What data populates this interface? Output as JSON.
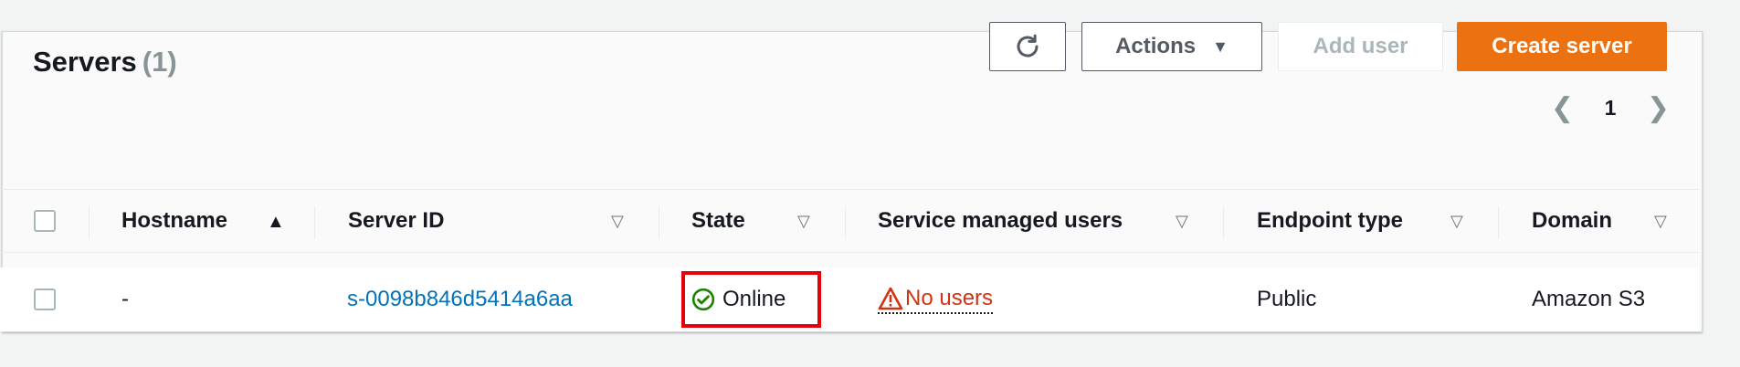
{
  "header": {
    "title": "Servers",
    "count": "(1)"
  },
  "toolbar": {
    "refresh_icon": "refresh-icon",
    "actions_label": "Actions",
    "add_user_label": "Add user",
    "create_server_label": "Create server"
  },
  "pagination": {
    "current_page": "1"
  },
  "table": {
    "columns": [
      {
        "label": "Hostname",
        "sort": "ascending"
      },
      {
        "label": "Server ID",
        "sort": "none"
      },
      {
        "label": "State",
        "sort": "none"
      },
      {
        "label": "Service managed users",
        "sort": "none"
      },
      {
        "label": "Endpoint type",
        "sort": "none"
      },
      {
        "label": "Domain",
        "sort": "none"
      }
    ],
    "rows": [
      {
        "hostname": "-",
        "server_id": "s-0098b846d5414a6aa",
        "state": "Online",
        "service_managed_users": "No users",
        "endpoint_type": "Public",
        "domain": "Amazon S3"
      }
    ]
  },
  "colors": {
    "primary": "#ec7211",
    "link": "#0073bb",
    "success": "#1d8102",
    "error": "#d13212",
    "highlight": "#e5000b"
  }
}
